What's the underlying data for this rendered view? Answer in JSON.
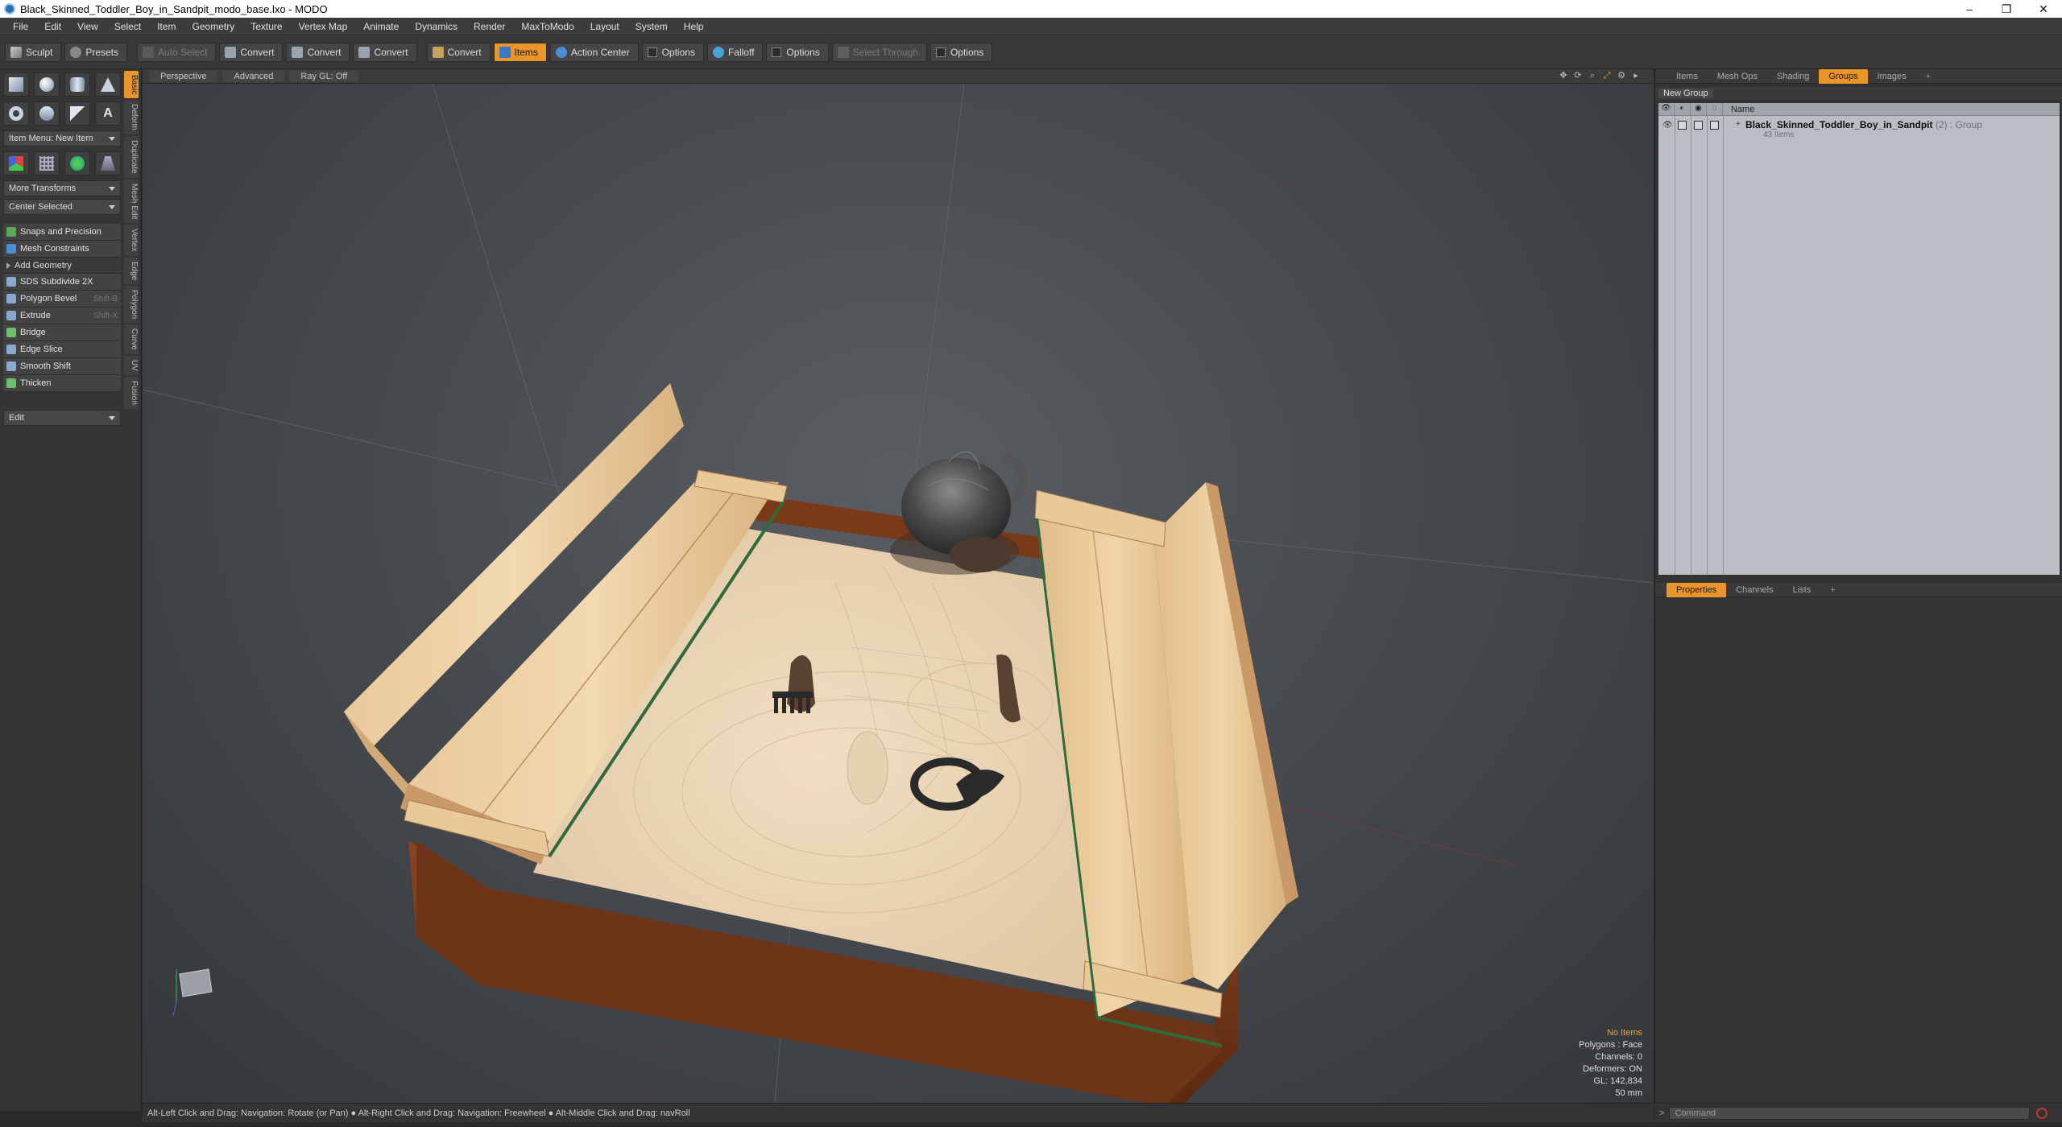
{
  "window": {
    "title": "Black_Skinned_Toddler_Boy_in_Sandpit_modo_base.lxo - MODO",
    "minimize": "–",
    "maximize": "❐",
    "close": "✕"
  },
  "menu": [
    "File",
    "Edit",
    "View",
    "Select",
    "Item",
    "Geometry",
    "Texture",
    "Vertex Map",
    "Animate",
    "Dynamics",
    "Render",
    "MaxToModo",
    "Layout",
    "System",
    "Help"
  ],
  "toolbar": {
    "sculpt": "Sculpt",
    "presets": "Presets",
    "auto_select": "Auto Select",
    "convert1": "Convert",
    "convert2": "Convert",
    "convert3": "Convert",
    "convert4": "Convert",
    "items": "Items",
    "action_center": "Action Center",
    "options1": "Options",
    "falloff": "Falloff",
    "options2": "Options",
    "select_through": "Select Through",
    "options3": "Options"
  },
  "left": {
    "item_menu": "Item Menu: New Item",
    "more_transforms": "More Transforms",
    "center_selected": "Center Selected",
    "snaps": "Snaps and Precision",
    "constraints": "Mesh Constraints",
    "add_geometry": "Add Geometry",
    "tools": [
      {
        "label": "SDS Subdivide 2X",
        "shortcut": ""
      },
      {
        "label": "Polygon Bevel",
        "shortcut": "Shift-B"
      },
      {
        "label": "Extrude",
        "shortcut": "Shift-X"
      },
      {
        "label": "Bridge",
        "shortcut": ""
      },
      {
        "label": "Edge Slice",
        "shortcut": ""
      },
      {
        "label": "Smooth Shift",
        "shortcut": ""
      },
      {
        "label": "Thicken",
        "shortcut": ""
      }
    ],
    "edit": "Edit",
    "vtabs": [
      "Basic",
      "Deform",
      "Duplicate",
      "Mesh Edit",
      "Vertex",
      "Edge",
      "Polygon",
      "Curve",
      "UV",
      "Fusion"
    ]
  },
  "viewport": {
    "perspective": "Perspective",
    "advanced": "Advanced",
    "raygl": "Ray GL: Off",
    "hud": {
      "selection": "No Items",
      "polygons": "Polygons : Face",
      "channels": "Channels: 0",
      "deformers": "Deformers: ON",
      "gl": "GL: 142,834",
      "focal": "50 mm"
    }
  },
  "status": "Alt-Left Click and Drag: Navigation: Rotate (or Pan) ●  Alt-Right Click and Drag: Navigation: Freewheel ●  Alt-Middle Click and Drag: navRoll",
  "right": {
    "tabs": [
      "Items",
      "Mesh Ops",
      "Shading",
      "Groups",
      "Images"
    ],
    "new_group": "New Group",
    "col_name": "Name",
    "group_name": "Black_Skinned_Toddler_Boy_in_Sandpit",
    "group_type": "(2) : Group",
    "group_sub": "43 Items",
    "prop_tabs": [
      "Properties",
      "Channels",
      "Lists"
    ],
    "command_placeholder": "Command"
  },
  "colors": {
    "accent": "#e8952a",
    "wood_light": "#e8c99a",
    "wood_dark": "#7a3a18",
    "sand": "#e6d2b3"
  }
}
